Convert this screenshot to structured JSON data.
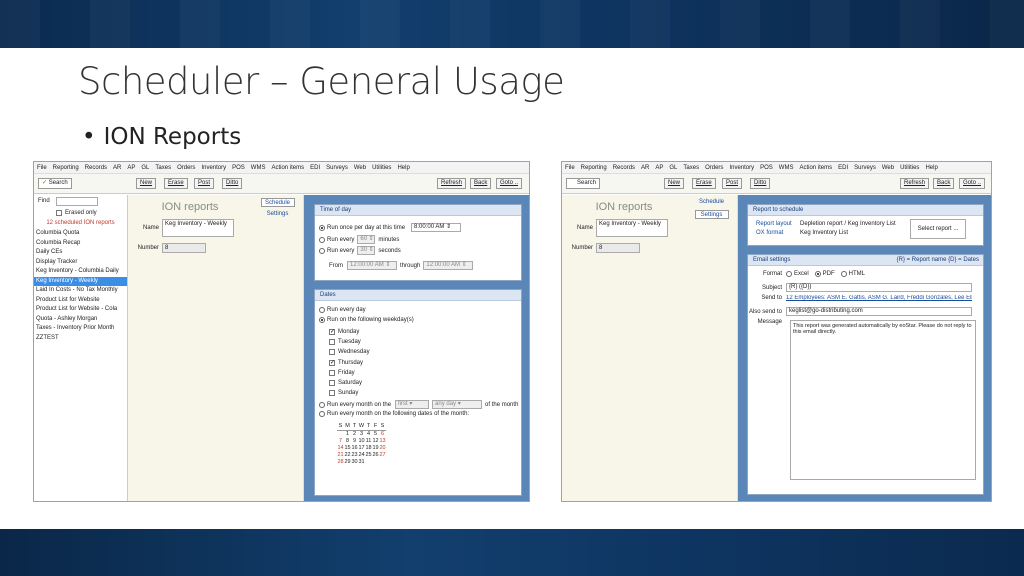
{
  "slide": {
    "title": "Scheduler – General Usage",
    "bullet": "ION Reports"
  },
  "menu": [
    "File",
    "Reporting",
    "Records",
    "AR",
    "AP",
    "GL",
    "Taxes",
    "Orders",
    "Inventory",
    "POS",
    "WMS",
    "Action items",
    "EDI",
    "Surveys",
    "Web",
    "Utilities",
    "Help"
  ],
  "toolbar": {
    "search": "Search",
    "new": "New",
    "erase": "Erase",
    "post": "Post",
    "ditto": "Ditto",
    "refresh": "Refresh",
    "back": "Back",
    "goto": "Goto .."
  },
  "list": {
    "find_label": "Find",
    "erased_only": "Erased only",
    "count_text": "12 scheduled ION reports",
    "items": [
      "Columbia Quota",
      "Columbia Recap",
      "Daily CEs",
      "Display Tracker",
      "Keg Inventory - Columbia Daily",
      "Keg Inventory - Weekly",
      "Laid In Costs - No Tax Monthly",
      "Product List for Website",
      "Product List for Website - Cola",
      "Quota - Ashley Morgan",
      "Taxes - Inventory Prior Month",
      "ZZTEST"
    ],
    "selected_index": 5
  },
  "form": {
    "title": "ION reports",
    "name_label": "Name",
    "name_value": "Keg Inventory - Weekly",
    "number_label": "Number",
    "number_value": "8"
  },
  "tabs": {
    "schedule": "Schedule",
    "settings": "Settings"
  },
  "time_of_day": {
    "header": "Time of day",
    "once_label": "Run once per day at this time",
    "once_value": "8:00:00 AM",
    "every_min_label": "Run every",
    "every_min_value": "60",
    "every_min_unit": "minutes",
    "every_sec_label": "Run every",
    "every_sec_value": "30",
    "every_sec_unit": "seconds",
    "from_label": "From",
    "from_value": "12:00:00 AM",
    "through_label": "through",
    "through_value": "12:00:00 AM"
  },
  "dates": {
    "header": "Dates",
    "every_day": "Run every day",
    "weekdays_label": "Run on the following weekday(s)",
    "weekdays": [
      {
        "label": "Monday",
        "checked": true
      },
      {
        "label": "Tuesday",
        "checked": false
      },
      {
        "label": "Wednesday",
        "checked": false
      },
      {
        "label": "Thursday",
        "checked": true
      },
      {
        "label": "Friday",
        "checked": false
      },
      {
        "label": "Saturday",
        "checked": false
      },
      {
        "label": "Sunday",
        "checked": false
      }
    ],
    "monthly_label": "Run every month on the",
    "monthly_first": "first",
    "monthly_day": "any day",
    "monthly_suffix": "of the month",
    "dates_label": "Run every month on the following dates of the month:",
    "cal_head": [
      "S",
      "M",
      "T",
      "W",
      "T",
      "F",
      "S"
    ],
    "cal_rows": [
      [
        "",
        "1",
        "2",
        "3",
        "4",
        "5",
        "6"
      ],
      [
        "7",
        "8",
        "9",
        "10",
        "11",
        "12",
        "13"
      ],
      [
        "14",
        "15",
        "16",
        "17",
        "18",
        "19",
        "20"
      ],
      [
        "21",
        "22",
        "23",
        "24",
        "25",
        "26",
        "27"
      ],
      [
        "28",
        "29",
        "30",
        "31",
        "",
        "",
        ""
      ]
    ]
  },
  "settings": {
    "report_header": "Report to schedule",
    "layout_label": "Report layout",
    "layout_value": "Depletion report / Keg Inventory List",
    "ox_label": "OX format",
    "ox_value": "Keg Inventory List",
    "select_btn": "Select report ...",
    "email_header": "Email settings",
    "email_hint": "{R} = Report name    {D} = Dates",
    "format_label": "Format",
    "format_opts": [
      "Excel",
      "PDF",
      "HTML"
    ],
    "subject_label": "Subject",
    "subject_value": "{R} ({D})",
    "sendto_label": "Send to",
    "sendto_value": "12 Employees: ASM E. Gattis, ASM G. Laird, Freddi Gonzales, Lee Ella, Sal...",
    "alsosend_label": "Also send to",
    "alsosend_value": "keglist@go-distributing.com",
    "message_label": "Message",
    "message_value": "This report was generated automatically by eoStar.  Please do not reply to this email directly."
  },
  "colors": {
    "banner": "#123f6e",
    "right_panel_bg": "#5b86b8",
    "selection": "#3a8ee6",
    "form_bg": "#f7f6e9"
  }
}
